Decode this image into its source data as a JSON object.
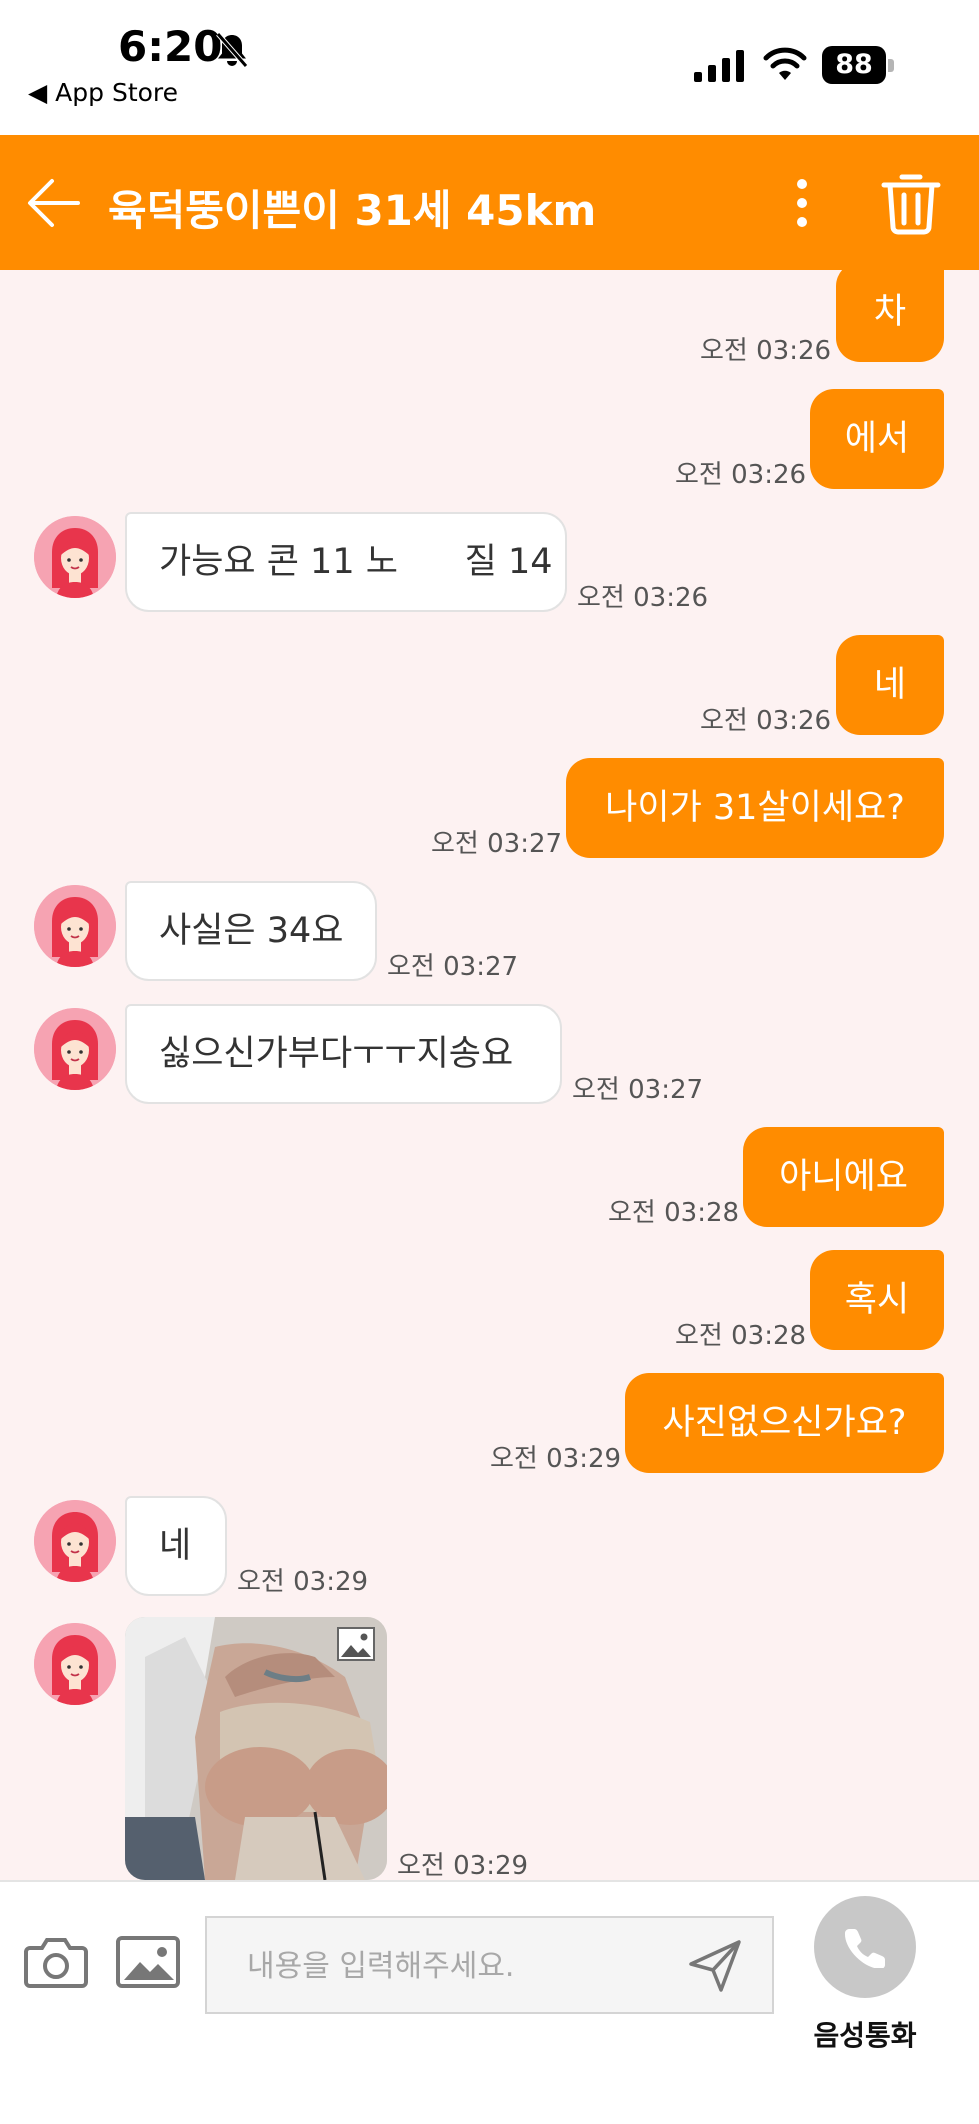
{
  "status_bar": {
    "time": "6:20",
    "back_app": "◀ App Store",
    "battery": "88"
  },
  "header": {
    "title": "육덕뚱이쁜이 31세 45km"
  },
  "messages": [
    {
      "side": "sent",
      "text": "차",
      "time": "오전 03:26"
    },
    {
      "side": "sent",
      "text": "에서",
      "time": "오전 03:26"
    },
    {
      "side": "received",
      "text": "가능요 콘 11 노      질 14",
      "time": "오전 03:26"
    },
    {
      "side": "sent",
      "text": "네",
      "time": "오전 03:26"
    },
    {
      "side": "sent",
      "text": "나이가 31살이세요?",
      "time": "오전 03:27"
    },
    {
      "side": "received",
      "text": "사실은 34요",
      "time": "오전 03:27"
    },
    {
      "side": "received",
      "text": "싫으신가부다ㅜㅜ지송요",
      "time": "오전 03:27"
    },
    {
      "side": "sent",
      "text": "아니에요",
      "time": "오전 03:28"
    },
    {
      "side": "sent",
      "text": "혹시",
      "time": "오전 03:28"
    },
    {
      "side": "sent",
      "text": "사진없으신가요?",
      "time": "오전 03:29"
    },
    {
      "side": "received",
      "text": "네",
      "time": "오전 03:29"
    },
    {
      "side": "received",
      "type": "photo",
      "time": "오전 03:29"
    }
  ],
  "composer": {
    "placeholder": "내용을 입력해주세요.",
    "call_label": "음성통화"
  },
  "colors": {
    "accent": "#ff8c00",
    "chat_background": "#fdf2f2",
    "received_bubble": "#ffffff"
  },
  "icons": [
    "bell-slash-icon",
    "signal-icon",
    "wifi-icon",
    "battery-icon",
    "back-arrow-icon",
    "more-vertical-icon",
    "trash-icon",
    "avatar-icon",
    "image-badge-icon",
    "camera-icon",
    "gallery-icon",
    "send-icon",
    "phone-icon"
  ]
}
